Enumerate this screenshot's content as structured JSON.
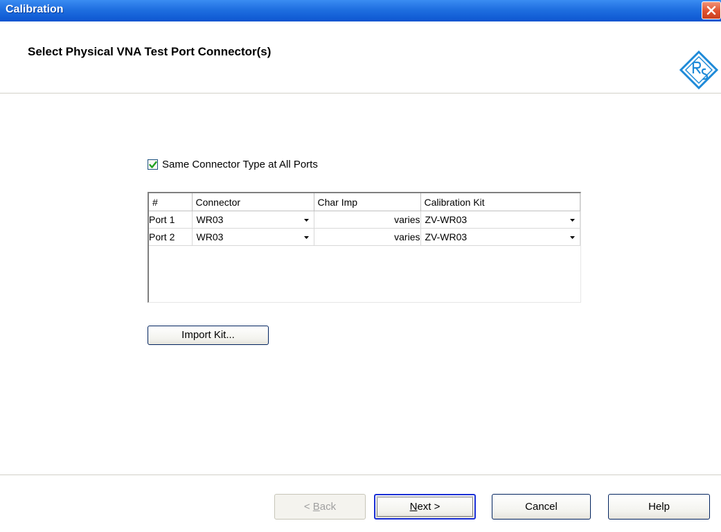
{
  "window": {
    "title": "Calibration",
    "close_icon": "close-icon"
  },
  "header": {
    "heading": "Select Physical VNA Test Port Connector(s)",
    "logo": "rohde-schwarz-logo"
  },
  "options": {
    "same_connector_label": "Same Connector Type at All Ports",
    "same_connector_checked": true
  },
  "grid": {
    "columns": [
      "#",
      "Connector",
      "Char Imp",
      "Calibration Kit"
    ],
    "rows": [
      {
        "port": "Port 1",
        "connector": "WR03",
        "char_imp": "varies",
        "cal_kit": "ZV-WR03"
      },
      {
        "port": "Port 2",
        "connector": "WR03",
        "char_imp": "varies",
        "cal_kit": "ZV-WR03"
      }
    ]
  },
  "buttons": {
    "import_kit": "Import Kit...",
    "back_prefix": "< ",
    "back_accel": "B",
    "back_rest": "ack",
    "next_accel": "N",
    "next_rest": "ext >",
    "cancel": "Cancel",
    "help": "Help"
  },
  "colors": {
    "titlebar": "#0c55d0",
    "next_focus": "#1a2fd6",
    "check": "#21a121"
  }
}
